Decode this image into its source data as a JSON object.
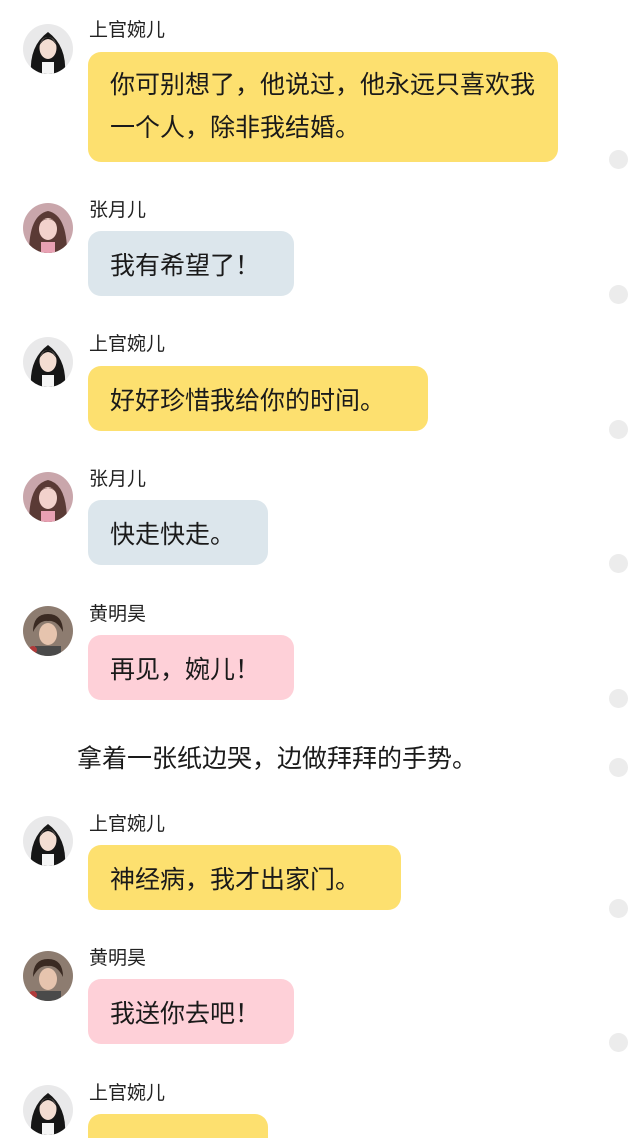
{
  "messages": [
    {
      "sender": "上官婉儿",
      "text": "你可别想了，他说过，他永远只喜欢我一个人，除非我结婚。",
      "color": "yellow",
      "avatar": "girl-longhair"
    },
    {
      "sender": "张月儿",
      "text": "我有希望了！",
      "color": "blue",
      "avatar": "girl-pink"
    },
    {
      "sender": "上官婉儿",
      "text": "好好珍惜我给你的时间。",
      "color": "yellow",
      "avatar": "girl-longhair"
    },
    {
      "sender": "张月儿",
      "text": "快走快走。",
      "color": "blue",
      "avatar": "girl-pink"
    },
    {
      "sender": "黄明昊",
      "text": "再见，婉儿！",
      "color": "pink",
      "avatar": "boy"
    },
    {
      "sender": "上官婉儿",
      "text": "神经病，我才出家门。",
      "color": "yellow",
      "avatar": "girl-longhair"
    },
    {
      "sender": "黄明昊",
      "text": "我送你去吧！",
      "color": "pink",
      "avatar": "boy"
    },
    {
      "sender": "上官婉儿",
      "text": "",
      "color": "yellow",
      "avatar": "girl-longhair"
    }
  ],
  "narration": "拿着一张纸边哭，边做拜拜的手势。",
  "colors": {
    "yellow": "#fde06f",
    "blue": "#dce6ec",
    "pink": "#fed0d8",
    "status_dot": "#ececec"
  }
}
